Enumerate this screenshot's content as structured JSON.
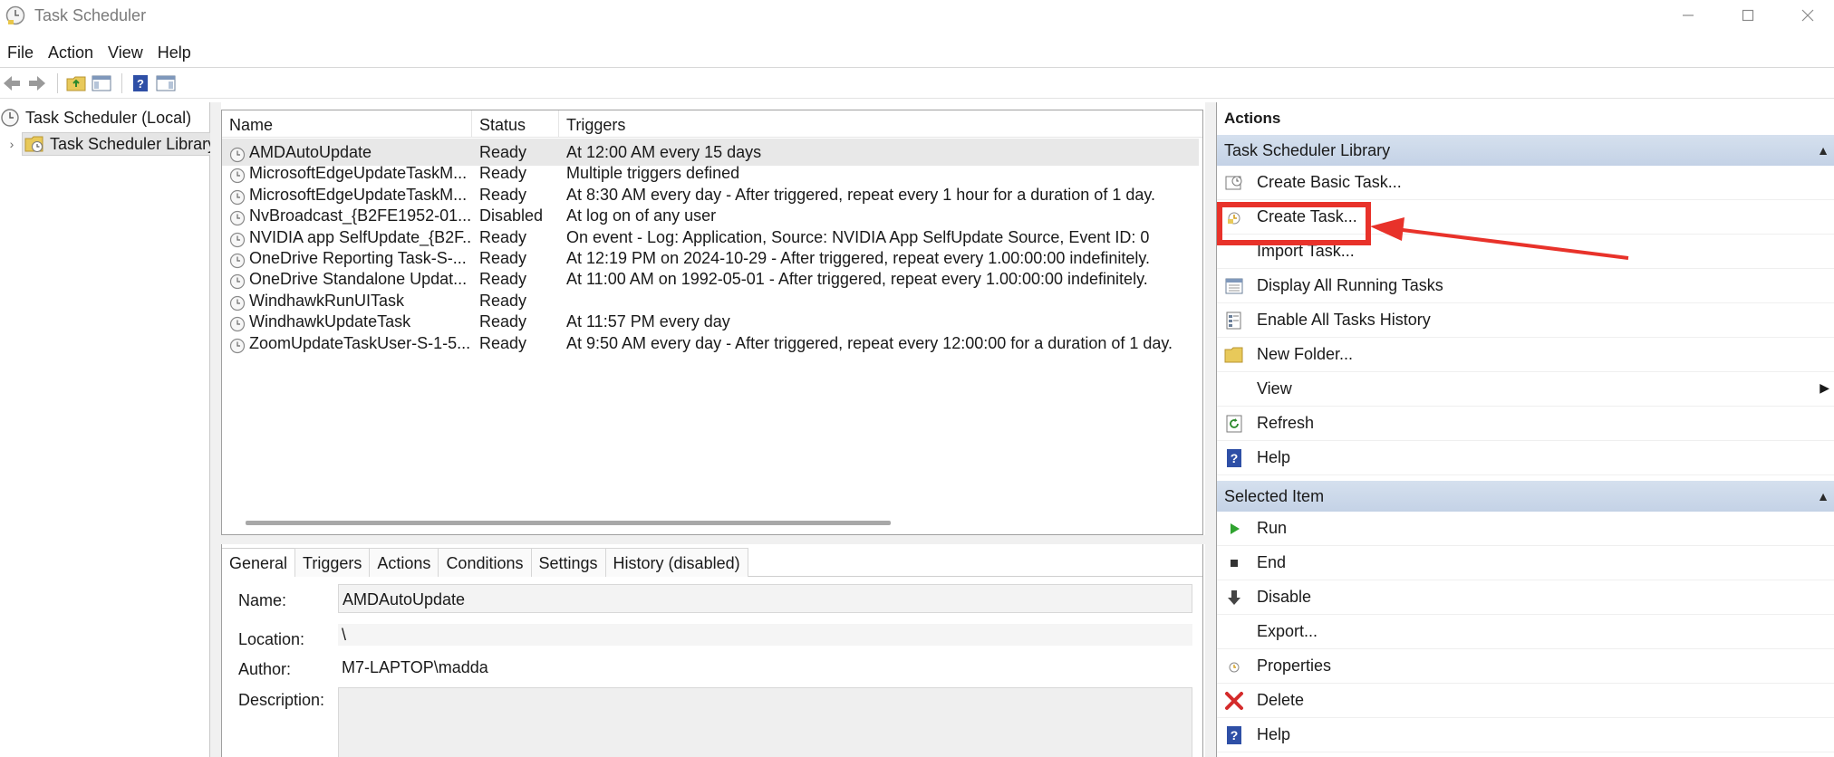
{
  "window": {
    "title": "Task Scheduler"
  },
  "menu": [
    "File",
    "Action",
    "View",
    "Help"
  ],
  "tree": {
    "root": "Task Scheduler (Local)",
    "library": "Task Scheduler Library"
  },
  "task_list": {
    "columns": {
      "name": "Name",
      "status": "Status",
      "triggers": "Triggers"
    },
    "rows": [
      {
        "name": "AMDAutoUpdate",
        "status": "Ready",
        "triggers": "At 12:00 AM every 15 days"
      },
      {
        "name": "MicrosoftEdgeUpdateTaskM...",
        "status": "Ready",
        "triggers": "Multiple triggers defined"
      },
      {
        "name": "MicrosoftEdgeUpdateTaskM...",
        "status": "Ready",
        "triggers": "At 8:30 AM every day - After triggered, repeat every 1 hour for a duration of 1 day."
      },
      {
        "name": "NvBroadcast_{B2FE1952-01...",
        "status": "Disabled",
        "triggers": "At log on of any user"
      },
      {
        "name": "NVIDIA app SelfUpdate_{B2F...",
        "status": "Ready",
        "triggers": "On event - Log: Application, Source: NVIDIA App SelfUpdate Source, Event ID: 0"
      },
      {
        "name": "OneDrive Reporting Task-S-...",
        "status": "Ready",
        "triggers": "At 12:19 PM on 2024-10-29 - After triggered, repeat every 1.00:00:00 indefinitely."
      },
      {
        "name": "OneDrive Standalone Updat...",
        "status": "Ready",
        "triggers": "At 11:00 AM on 1992-05-01 - After triggered, repeat every 1.00:00:00 indefinitely."
      },
      {
        "name": "WindhawkRunUITask",
        "status": "Ready",
        "triggers": ""
      },
      {
        "name": "WindhawkUpdateTask",
        "status": "Ready",
        "triggers": "At 11:57 PM every day"
      },
      {
        "name": "ZoomUpdateTaskUser-S-1-5...",
        "status": "Ready",
        "triggers": "At 9:50 AM every day - After triggered, repeat every 12:00:00 for a duration of 1 day."
      }
    ]
  },
  "details": {
    "tabs": [
      "General",
      "Triggers",
      "Actions",
      "Conditions",
      "Settings",
      "History (disabled)"
    ],
    "name_label": "Name:",
    "name_value": "AMDAutoUpdate",
    "location_label": "Location:",
    "location_value": "\\",
    "author_label": "Author:",
    "author_value": "M7-LAPTOP\\madda",
    "description_label": "Description:"
  },
  "actions": {
    "title": "Actions",
    "group1": {
      "header": "Task Scheduler Library",
      "items": [
        {
          "label": "Create Basic Task...",
          "icon": "create-basic-task-icon"
        },
        {
          "label": "Create Task...",
          "icon": "create-task-icon"
        },
        {
          "label": "Import Task...",
          "icon": "none"
        },
        {
          "label": "Display All Running Tasks",
          "icon": "running-tasks-icon"
        },
        {
          "label": "Enable All Tasks History",
          "icon": "history-icon"
        },
        {
          "label": "New Folder...",
          "icon": "folder-icon"
        },
        {
          "label": "View",
          "icon": "none"
        },
        {
          "label": "Refresh",
          "icon": "refresh-icon"
        },
        {
          "label": "Help",
          "icon": "help-icon"
        }
      ]
    },
    "group2": {
      "header": "Selected Item",
      "items": [
        {
          "label": "Run",
          "icon": "run-icon"
        },
        {
          "label": "End",
          "icon": "end-icon"
        },
        {
          "label": "Disable",
          "icon": "disable-icon"
        },
        {
          "label": "Export...",
          "icon": "none"
        },
        {
          "label": "Properties",
          "icon": "properties-icon"
        },
        {
          "label": "Delete",
          "icon": "delete-icon"
        },
        {
          "label": "Help",
          "icon": "help-icon"
        }
      ]
    }
  },
  "colors": {
    "highlight": "#e8322a",
    "group_header": "#c9d6e8",
    "selection": "#e8e8e8"
  }
}
